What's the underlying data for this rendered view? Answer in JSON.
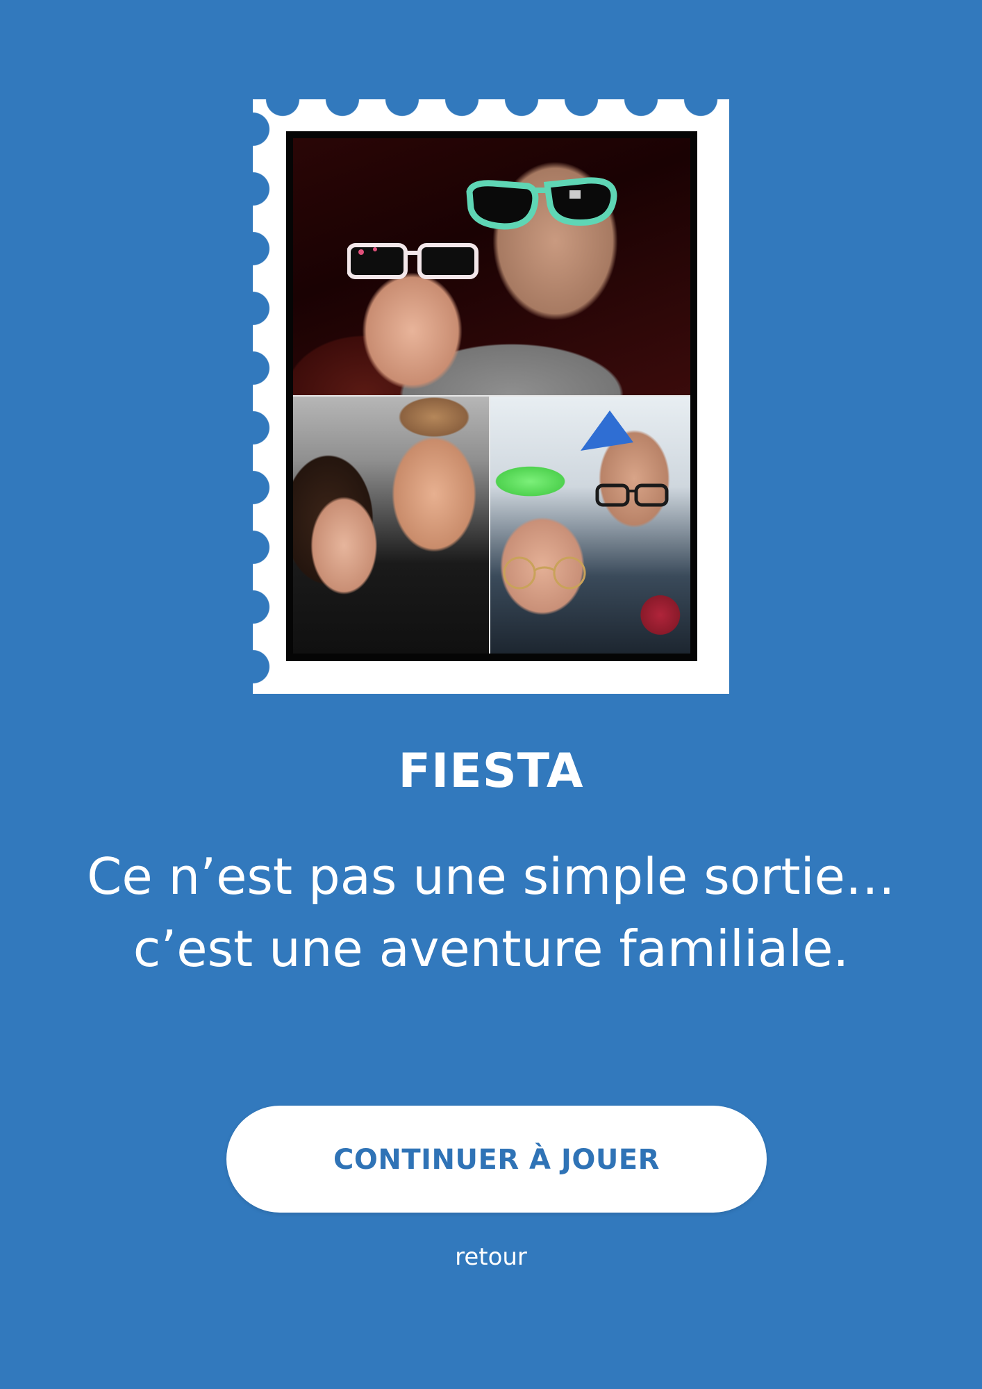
{
  "theme": {
    "background_color": "#3279bd",
    "button_color": "#ffffff",
    "button_text_color": "#2f73b6",
    "stamp_color": "#ffffff"
  },
  "stamp": {
    "photos": [
      {
        "name": "photo-couple-sunglasses"
      },
      {
        "name": "photo-couple-selfie"
      },
      {
        "name": "photo-party-selfie"
      }
    ]
  },
  "card": {
    "title": "FIESTA",
    "tagline_line1": "Ce n’est pas une simple sortie…",
    "tagline_line2": "c’est une aventure familiale."
  },
  "actions": {
    "continue_label": "CONTINUER À JOUER",
    "back_label": "retour"
  }
}
